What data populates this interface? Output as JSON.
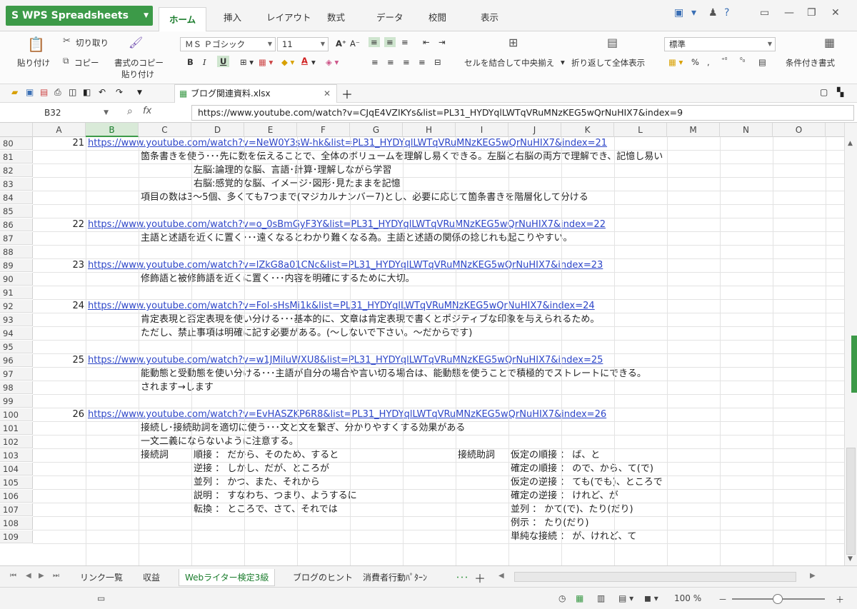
{
  "app": {
    "name": "WPS Spreadsheets"
  },
  "menu": [
    "ホーム",
    "挿入",
    "レイアウト",
    "数式",
    "データ",
    "校閲",
    "表示"
  ],
  "ribbon": {
    "cut": "切り取り",
    "paste": "貼り付け",
    "copy": "コピー",
    "format_copy_1": "書式のコピー",
    "format_copy_2": "貼り付け",
    "font_name": "ＭＳ Ｐゴシック",
    "font_size": "11",
    "merge": "セルを結合して中央揃え",
    "wrap": "折り返して全体表示",
    "number_format": "標準",
    "conditional": "条件付き書式",
    "bold": "B",
    "italic": "I",
    "underline": "U",
    "percent": "%",
    "comma": ","
  },
  "file_tab": "ブログ関連資料.xlsx",
  "formula_bar": {
    "cell_ref": "B32",
    "fx": "fx",
    "value": "https://www.youtube.com/watch?v=CJqE4VZIKYs&list=PL31_HYDYqlLWTqVRuMNzKEG5wQrNuHIX7&index=9"
  },
  "columns": [
    "A",
    "B",
    "C",
    "D",
    "E",
    "F",
    "G",
    "H",
    "I",
    "J",
    "K",
    "L",
    "M",
    "N",
    "O"
  ],
  "rows": [
    "80",
    "81",
    "82",
    "83",
    "84",
    "85",
    "86",
    "87",
    "88",
    "89",
    "90",
    "91",
    "92",
    "93",
    "94",
    "95",
    "96",
    "97",
    "98",
    "99",
    "100",
    "101",
    "102",
    "103",
    "104",
    "105",
    "106",
    "107",
    "108",
    "109"
  ],
  "cells": {
    "r80_num": "21",
    "r80_link": "https://www.youtube.com/watch?v=NeW0Y3sW-hk&list=PL31_HYDYqlLWTqVRuMNzKEG5wQrNuHIX7&index=21",
    "r81": "箇条書きを使う･･･先に数を伝えることで、全体のボリュームを理解し易くできる。左脳と右脳の両方で理解でき、記憶し易い",
    "r82": "左脳:論理的な脳、言語･計算･理解しながら学習",
    "r83": "右脳:感覚的な脳、イメージ･図形･見たままを記憶",
    "r84": "項目の数は3～5個、多くても7つまで(マジカルナンバー7)とし、必要に応じて箇条書きを階層化して分ける",
    "r86_num": "22",
    "r86_link": "https://www.youtube.com/watch?v=o_0sBmGyF3Y&list=PL31_HYDYqlLWTqVRuMNzKEG5wQrNuHIX7&index=22",
    "r87": "主語と述語を近くに置く･･･遠くなるとわかり難くなる為。主語と述語の関係の捻じれも起こりやすい。",
    "r89_num": "23",
    "r89_link": "https://www.youtube.com/watch?v=lZkG8a01CNc&list=PL31_HYDYqlLWTqVRuMNzKEG5wQrNuHIX7&index=23",
    "r90": "修飾語と被修飾語を近くに置く･･･内容を明確にするために大切。",
    "r92_num": "24",
    "r92_link": "https://www.youtube.com/watch?v=Fol-sHsMi1k&list=PL31_HYDYqlLWTqVRuMNzKEG5wQrNuHIX7&index=24",
    "r93": "肯定表現と否定表現を使い分ける･･･基本的に、文章は肯定表現で書くとポジティブな印象を与えられるため。",
    "r94": "ただし、禁止事項は明確に記す必要がある。(～しないで下さい。～だからです)",
    "r96_num": "25",
    "r96_link": "https://www.youtube.com/watch?v=w1JMiluWXU8&list=PL31_HYDYqlLWTqVRuMNzKEG5wQrNuHIX7&index=25",
    "r97": "能動態と受動態を使い分ける･･･主語が自分の場合や言い切る場合は、能動態を使うことで積極的でストレートにできる。",
    "r98": "されます→します",
    "r100_num": "26",
    "r100_link": "https://www.youtube.com/watch?v=EvHASZKP6R8&list=PL31_HYDYqlLWTqVRuMNzKEG5wQrNuHIX7&index=26",
    "r101": "接続し･接続助詞を適切に使う･･･文と文を繋ぎ、分かりやすくする効果がある",
    "r102": "一文二義にならないように注意する。",
    "r103_c": "接続詞",
    "r103_d": "順接 ： だから、そのため、すると",
    "r103_i": "接続助詞",
    "r103_j": "仮定の順接 ： ば、と",
    "r104_d": "逆接 ： しかし、だが、ところが",
    "r104_j": "確定の順接 ： ので、から、て(で)",
    "r105_d": "並列 ： かつ、また、それから",
    "r105_j": "仮定の逆接 ： ても(でも)、ところで",
    "r106_d": "説明 ： すなわち、つまり、ようするに",
    "r106_j": "確定の逆接 ： けれど、が",
    "r107_d": "転換 ： ところで、さて、それでは",
    "r107_j": "並列 ： かて(で)、たり(だり)",
    "r108_j": "例示 ： たり(だり)",
    "r109_j": "単純な接続 ： が、けれど、て"
  },
  "sheets": [
    "リンク一覧",
    "収益",
    "Webライター検定3級",
    "ブログのヒント",
    "消費者行動ﾊﾟﾀｰﾝ"
  ],
  "sheet_more": "･･･",
  "status": {
    "zoom": "100 %",
    "minus": "－",
    "plus": "＋"
  }
}
